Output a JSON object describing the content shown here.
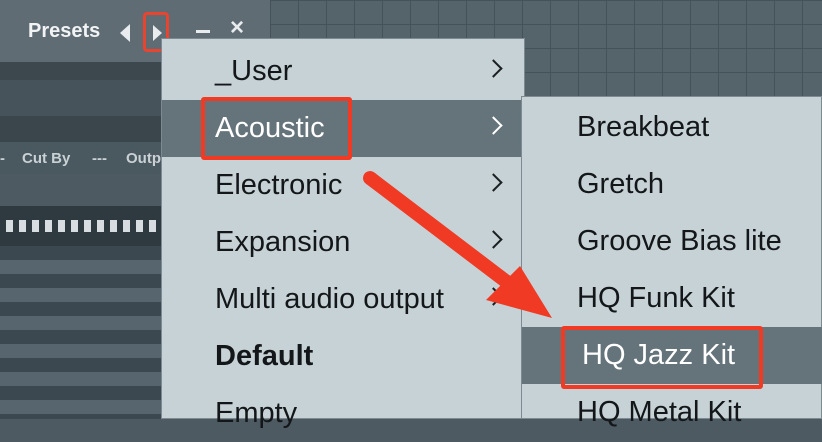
{
  "window": {
    "title": "Presets",
    "prev_icon": "triangle-left-icon",
    "next_icon": "triangle-right-icon",
    "minimize_icon": "minimize-icon",
    "close_icon": "close-icon",
    "close_glyph": "×"
  },
  "background": {
    "columns": [
      "-",
      "Cut By",
      "---",
      "Output"
    ]
  },
  "menu_primary": {
    "items": [
      {
        "label": "_User",
        "has_submenu": true
      },
      {
        "label": "Acoustic",
        "has_submenu": true,
        "selected": true
      },
      {
        "label": "Electronic",
        "has_submenu": true
      },
      {
        "label": "Expansion",
        "has_submenu": true
      },
      {
        "label": "Multi audio output",
        "has_submenu": true
      },
      {
        "label": "Default",
        "bold": true
      },
      {
        "label": "Empty"
      }
    ]
  },
  "menu_submenu": {
    "items": [
      {
        "label": "Breakbeat"
      },
      {
        "label": "Gretch"
      },
      {
        "label": "Groove Bias lite"
      },
      {
        "label": "HQ Funk Kit"
      },
      {
        "label": "HQ Jazz Kit",
        "selected": true
      },
      {
        "label": "HQ Metal Kit"
      }
    ]
  },
  "colors": {
    "highlight": "#f03a23",
    "menu_bg": "#c7d2d7",
    "selected_bg": "#65737b"
  }
}
